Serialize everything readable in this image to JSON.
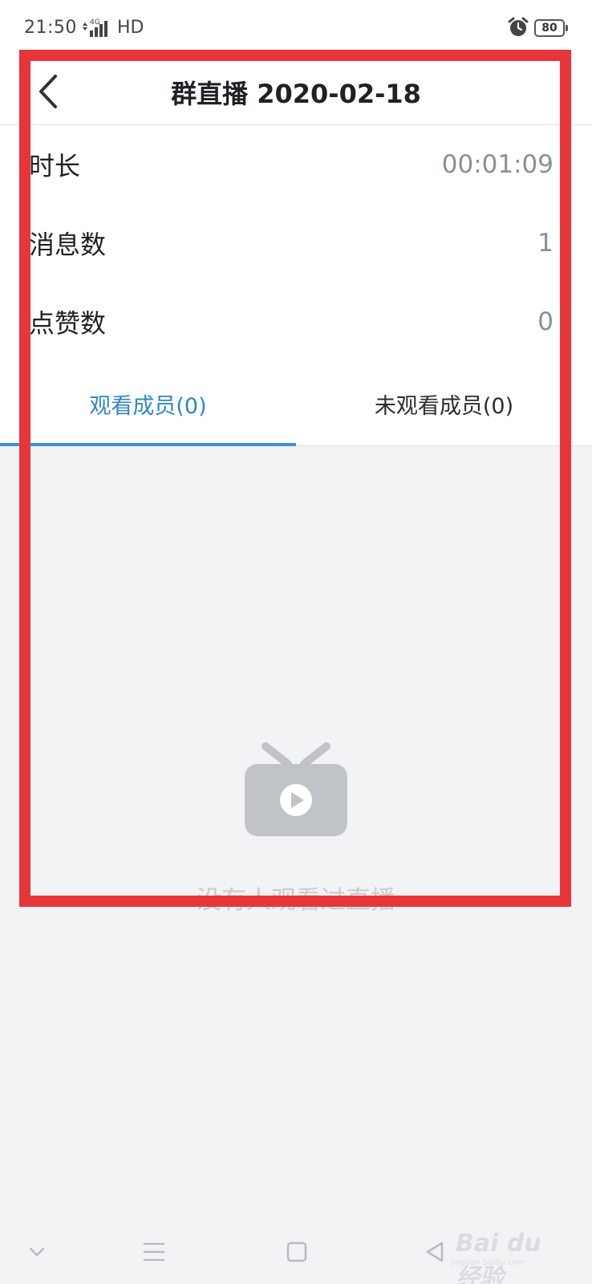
{
  "status_bar": {
    "time": "21:50",
    "network": "4G",
    "hd": "HD",
    "battery": "80"
  },
  "header": {
    "title": "群直播 2020-02-18",
    "back_icon": "chevron-left-icon"
  },
  "stats": [
    {
      "label": "时长",
      "value": "00:01:09"
    },
    {
      "label": "消息数",
      "value": "1"
    },
    {
      "label": "点赞数",
      "value": "0"
    }
  ],
  "tabs": [
    {
      "label": "观看成员(0)",
      "active": true
    },
    {
      "label": "未观看成员(0)",
      "active": false
    }
  ],
  "empty_state": {
    "icon": "tv-play-icon",
    "text": "没有人观看过直播"
  },
  "nav_bar": {
    "icons": [
      "chevron-down-icon",
      "menu-icon",
      "home-square-icon",
      "back-triangle-icon"
    ]
  },
  "watermark": {
    "text": "Bai du 经验",
    "sub": "jingyan.baidu.com"
  },
  "colors": {
    "accent": "#3b93d6",
    "annotation": "#e8353a",
    "background": "#f2f3f5"
  }
}
